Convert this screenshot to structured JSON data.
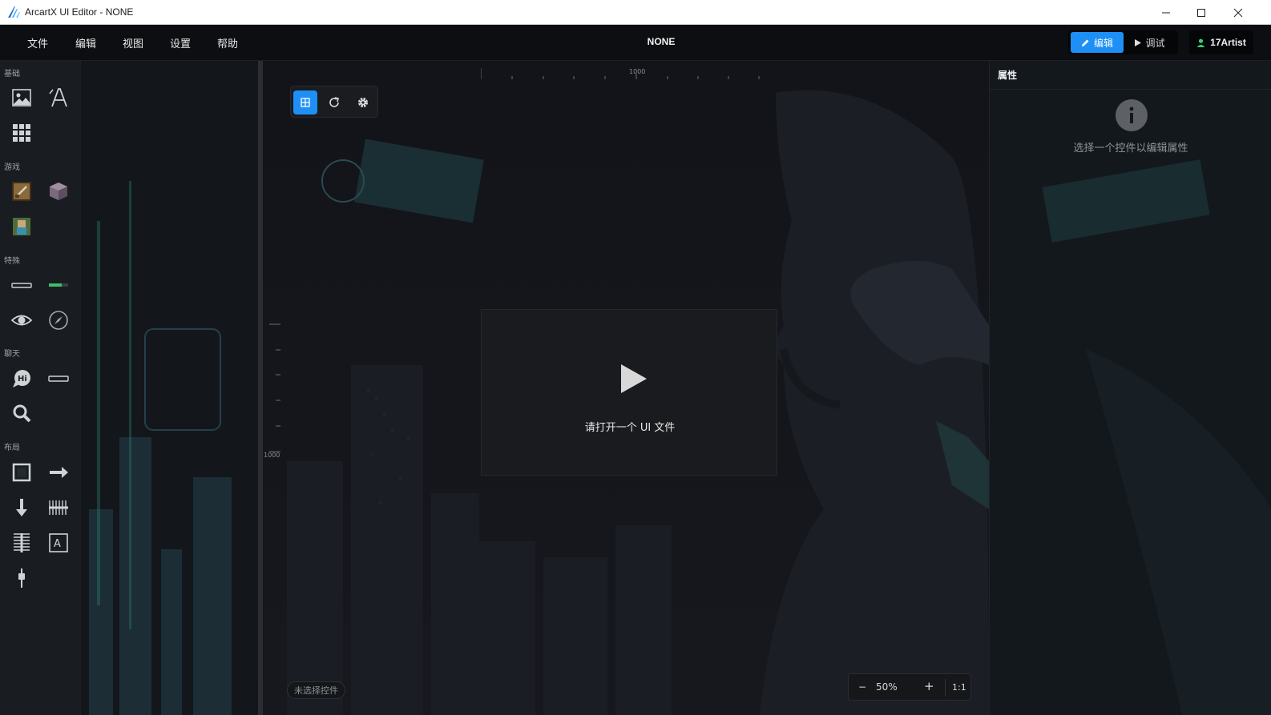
{
  "window": {
    "title": "ArcartX UI Editor - NONE",
    "controls": [
      "minimize-icon",
      "maximize-icon",
      "close-icon"
    ]
  },
  "menu": {
    "items": [
      "文件",
      "编辑",
      "视图",
      "设置",
      "帮助"
    ],
    "document_title": "NONE"
  },
  "mode": {
    "edit_label": "编辑",
    "debug_label": "调试"
  },
  "user": {
    "name": "17Artist"
  },
  "toolbox": {
    "sections": [
      "基础",
      "游戏",
      "特殊",
      "聊天",
      "布局"
    ],
    "tools": [
      {
        "icon": "image-icon"
      },
      {
        "icon": "text-icon"
      },
      {
        "icon": "grid-icon"
      },
      {
        "icon": "item-slot-icon"
      },
      {
        "icon": "cube-icon"
      },
      {
        "icon": "player-model-icon"
      },
      {
        "icon": "scrollbar-icon"
      },
      {
        "icon": "progress-bar-icon"
      },
      {
        "icon": "eye-icon"
      },
      {
        "icon": "compass-icon"
      },
      {
        "icon": "chat-bubble-icon"
      },
      {
        "icon": "input-field-icon"
      },
      {
        "icon": "search-icon"
      },
      {
        "icon": "frame-icon"
      },
      {
        "icon": "arrow-right-icon"
      },
      {
        "icon": "arrow-down-icon"
      },
      {
        "icon": "horizontal-layout-icon"
      },
      {
        "icon": "vertical-layout-icon"
      },
      {
        "icon": "text-box-icon"
      },
      {
        "icon": "slider-icon"
      }
    ]
  },
  "canvas": {
    "toolbar": [
      "grid-toggle-icon",
      "refresh-icon",
      "gear-icon"
    ],
    "ruler_h_label": "1000",
    "ruler_v_label": "1000",
    "empty_message": "请打开一个 UI 文件",
    "selection_status": "未选择控件",
    "zoom": {
      "minus": "−",
      "value": "50%",
      "plus": "+",
      "reset": "1:1"
    }
  },
  "properties": {
    "title": "属性",
    "hint": "选择一个控件以编辑属性"
  },
  "colors": {
    "accent": "#1e90f5",
    "menubar_bg": "#0d0e11",
    "canvas_bg": "#121418"
  }
}
